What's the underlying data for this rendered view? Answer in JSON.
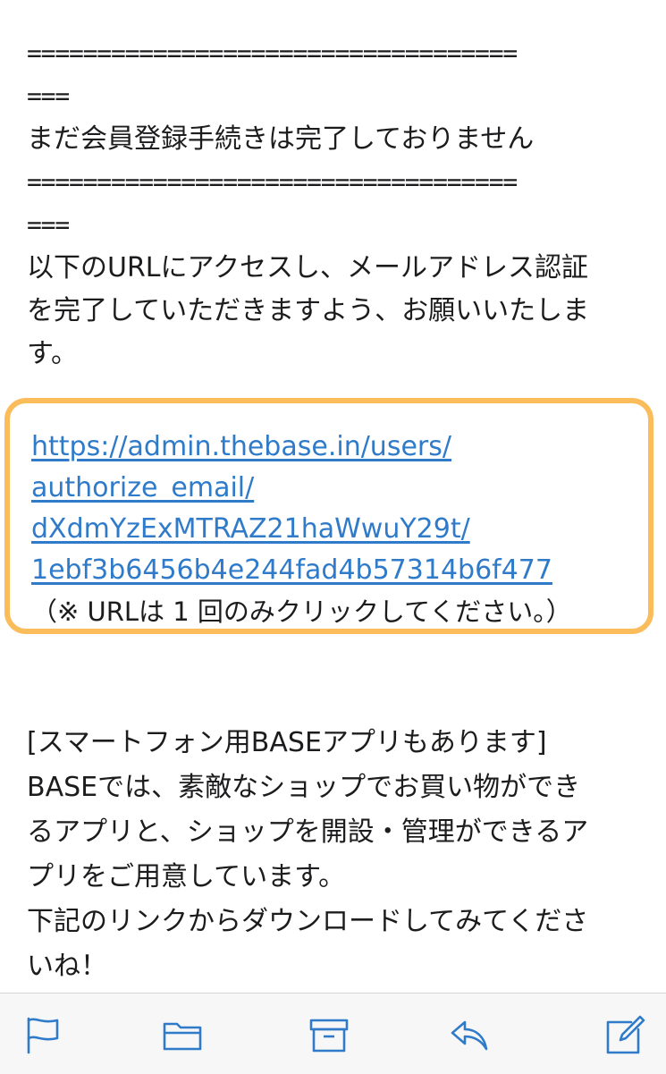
{
  "email": {
    "rule_line": "===================================",
    "rule_tail": "===",
    "status_message": "まだ会員登録手続きは完了しておりません",
    "instruction_lines": [
      "以下のURLにアクセスし、メールアドレス認証",
      "を完了していただきますよう、お願いいたしま",
      "す。"
    ],
    "auth_url_lines": [
      "https://admin.thebase.in/users/",
      "authorize_email/",
      "dXdmYzExMTRAZ21haWwuY29t/",
      "1ebf3b6456b4e244fad4b57314b6f477"
    ],
    "auth_url_note": "（※ URLは 1 回のみクリックしてください。）",
    "app_heading": "[スマートフォン用BASEアプリもあります]",
    "app_lines": [
      "BASEでは、素敵なショップでお買い物ができ",
      "るアプリと、ショップを開設・管理ができるア",
      "プリをご用意しています。",
      "下記のリンクからダウンロードしてみてくださ",
      "いね！"
    ]
  },
  "toolbar": {
    "icons": [
      "flag-icon",
      "folder-icon",
      "archive-icon",
      "reply-icon",
      "compose-icon"
    ],
    "accent_color": "#2f7bc9"
  },
  "colors": {
    "highlight_border": "#fbbd5c",
    "link": "#2f7bc9",
    "text": "#1c1c1e"
  }
}
